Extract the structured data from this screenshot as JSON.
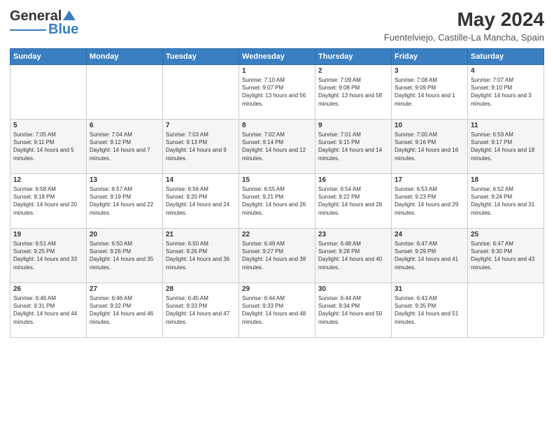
{
  "logo": {
    "line1": "General",
    "line2": "Blue"
  },
  "title": "May 2024",
  "subtitle": "Fuentelviejo, Castille-La Mancha, Spain",
  "days_header": [
    "Sunday",
    "Monday",
    "Tuesday",
    "Wednesday",
    "Thursday",
    "Friday",
    "Saturday"
  ],
  "weeks": [
    [
      {
        "day": "",
        "info": ""
      },
      {
        "day": "",
        "info": ""
      },
      {
        "day": "",
        "info": ""
      },
      {
        "day": "1",
        "info": "Sunrise: 7:10 AM\nSunset: 9:07 PM\nDaylight: 13 hours and 56 minutes."
      },
      {
        "day": "2",
        "info": "Sunrise: 7:09 AM\nSunset: 9:08 PM\nDaylight: 13 hours and 58 minutes."
      },
      {
        "day": "3",
        "info": "Sunrise: 7:08 AM\nSunset: 9:09 PM\nDaylight: 14 hours and 1 minute."
      },
      {
        "day": "4",
        "info": "Sunrise: 7:07 AM\nSunset: 9:10 PM\nDaylight: 14 hours and 3 minutes."
      }
    ],
    [
      {
        "day": "5",
        "info": "Sunrise: 7:05 AM\nSunset: 9:11 PM\nDaylight: 14 hours and 5 minutes."
      },
      {
        "day": "6",
        "info": "Sunrise: 7:04 AM\nSunset: 9:12 PM\nDaylight: 14 hours and 7 minutes."
      },
      {
        "day": "7",
        "info": "Sunrise: 7:03 AM\nSunset: 9:13 PM\nDaylight: 14 hours and 9 minutes."
      },
      {
        "day": "8",
        "info": "Sunrise: 7:02 AM\nSunset: 9:14 PM\nDaylight: 14 hours and 12 minutes."
      },
      {
        "day": "9",
        "info": "Sunrise: 7:01 AM\nSunset: 9:15 PM\nDaylight: 14 hours and 14 minutes."
      },
      {
        "day": "10",
        "info": "Sunrise: 7:00 AM\nSunset: 9:16 PM\nDaylight: 14 hours and 16 minutes."
      },
      {
        "day": "11",
        "info": "Sunrise: 6:59 AM\nSunset: 9:17 PM\nDaylight: 14 hours and 18 minutes."
      }
    ],
    [
      {
        "day": "12",
        "info": "Sunrise: 6:58 AM\nSunset: 9:18 PM\nDaylight: 14 hours and 20 minutes."
      },
      {
        "day": "13",
        "info": "Sunrise: 6:57 AM\nSunset: 9:19 PM\nDaylight: 14 hours and 22 minutes."
      },
      {
        "day": "14",
        "info": "Sunrise: 6:56 AM\nSunset: 9:20 PM\nDaylight: 14 hours and 24 minutes."
      },
      {
        "day": "15",
        "info": "Sunrise: 6:55 AM\nSunset: 9:21 PM\nDaylight: 14 hours and 26 minutes."
      },
      {
        "day": "16",
        "info": "Sunrise: 6:54 AM\nSunset: 9:22 PM\nDaylight: 14 hours and 28 minutes."
      },
      {
        "day": "17",
        "info": "Sunrise: 6:53 AM\nSunset: 9:23 PM\nDaylight: 14 hours and 29 minutes."
      },
      {
        "day": "18",
        "info": "Sunrise: 6:52 AM\nSunset: 9:24 PM\nDaylight: 14 hours and 31 minutes."
      }
    ],
    [
      {
        "day": "19",
        "info": "Sunrise: 6:51 AM\nSunset: 9:25 PM\nDaylight: 14 hours and 33 minutes."
      },
      {
        "day": "20",
        "info": "Sunrise: 6:50 AM\nSunset: 9:26 PM\nDaylight: 14 hours and 35 minutes."
      },
      {
        "day": "21",
        "info": "Sunrise: 6:50 AM\nSunset: 9:26 PM\nDaylight: 14 hours and 36 minutes."
      },
      {
        "day": "22",
        "info": "Sunrise: 6:49 AM\nSunset: 9:27 PM\nDaylight: 14 hours and 38 minutes."
      },
      {
        "day": "23",
        "info": "Sunrise: 6:48 AM\nSunset: 9:28 PM\nDaylight: 14 hours and 40 minutes."
      },
      {
        "day": "24",
        "info": "Sunrise: 6:47 AM\nSunset: 9:29 PM\nDaylight: 14 hours and 41 minutes."
      },
      {
        "day": "25",
        "info": "Sunrise: 6:47 AM\nSunset: 9:30 PM\nDaylight: 14 hours and 43 minutes."
      }
    ],
    [
      {
        "day": "26",
        "info": "Sunrise: 6:46 AM\nSunset: 9:31 PM\nDaylight: 14 hours and 44 minutes."
      },
      {
        "day": "27",
        "info": "Sunrise: 6:46 AM\nSunset: 9:32 PM\nDaylight: 14 hours and 46 minutes."
      },
      {
        "day": "28",
        "info": "Sunrise: 6:45 AM\nSunset: 9:33 PM\nDaylight: 14 hours and 47 minutes."
      },
      {
        "day": "29",
        "info": "Sunrise: 6:44 AM\nSunset: 9:33 PM\nDaylight: 14 hours and 48 minutes."
      },
      {
        "day": "30",
        "info": "Sunrise: 6:44 AM\nSunset: 9:34 PM\nDaylight: 14 hours and 50 minutes."
      },
      {
        "day": "31",
        "info": "Sunrise: 6:43 AM\nSunset: 9:35 PM\nDaylight: 14 hours and 51 minutes."
      },
      {
        "day": "",
        "info": ""
      }
    ]
  ]
}
